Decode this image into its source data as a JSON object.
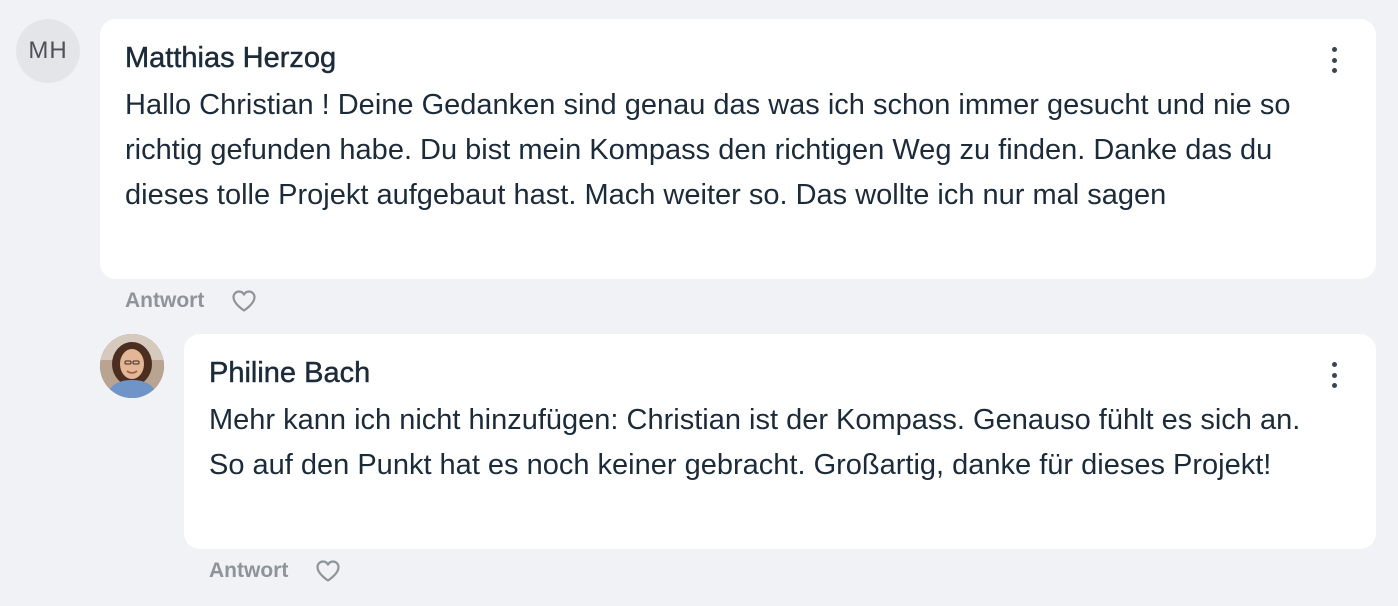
{
  "comments": [
    {
      "avatar_initials": "MH",
      "author": "Matthias Herzog",
      "text": "Hallo Christian ! Deine Gedanken sind genau das was ich schon immer gesucht und nie so richtig gefunden habe. Du bist mein Kompass den richtigen Weg zu finden. Danke das du dieses tolle Projekt aufgebaut hast. Mach weiter so. Das wollte ich nur mal sagen",
      "reply_label": "Antwort"
    },
    {
      "author": "Philine Bach",
      "text": "Mehr kann ich nicht hinzufügen: Christian ist der Kompass. Genauso fühlt es sich an. So auf den Punkt hat es noch keiner gebracht. Großartig, danke für dieses Projekt!",
      "reply_label": "Antwort"
    }
  ],
  "icons": {
    "menu": "more-vertical-icon",
    "like": "heart-outline-icon"
  },
  "colors": {
    "background": "#f0f2f5",
    "card": "#ffffff",
    "text": "#1c2b3a",
    "muted": "#8f949a"
  }
}
